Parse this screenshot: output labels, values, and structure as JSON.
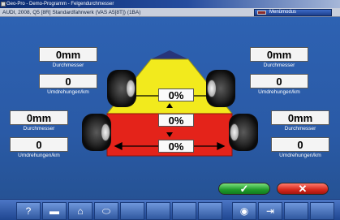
{
  "window": {
    "title": "Geo-Pro - Demo-Programm - Felgendurchmesser"
  },
  "infobar": {
    "vehicle": "AUDI, 2008, Q5 [8R] Standardfahrwerk (VAS A5[8T]) (1BA)",
    "menu_label": "Menümodus"
  },
  "front_left": {
    "diameter": "0mm",
    "diameter_label": "Durchmesser",
    "rev": "0",
    "rev_label": "Umdrehungen/km"
  },
  "front_right": {
    "diameter": "0mm",
    "diameter_label": "Durchmesser",
    "rev": "0",
    "rev_label": "Umdrehungen/km"
  },
  "rear_left": {
    "diameter": "0mm",
    "diameter_label": "Durchmesser",
    "rev": "0",
    "rev_label": "Umdrehungen/km"
  },
  "rear_right": {
    "diameter": "0mm",
    "diameter_label": "Durchmesser",
    "rev": "0",
    "rev_label": "Umdrehungen/km"
  },
  "center": {
    "front_pct": "0%",
    "middle_pct": "0%",
    "rear_pct": "0%"
  },
  "colors": {
    "yellow": "#f2ea1d",
    "red": "#e4231a",
    "navy": "#27357a"
  },
  "actions": {
    "ok_icon": "check-icon",
    "cancel_icon": "close-icon",
    "ok_glyph": "✓",
    "cancel_glyph": "✕"
  },
  "toolbar": {
    "help_glyph": "?",
    "flag_glyph": "▬",
    "home_glyph": "⌂",
    "car_glyph": "⬭",
    "steering_glyph": "◉",
    "export_glyph": "⇥"
  }
}
